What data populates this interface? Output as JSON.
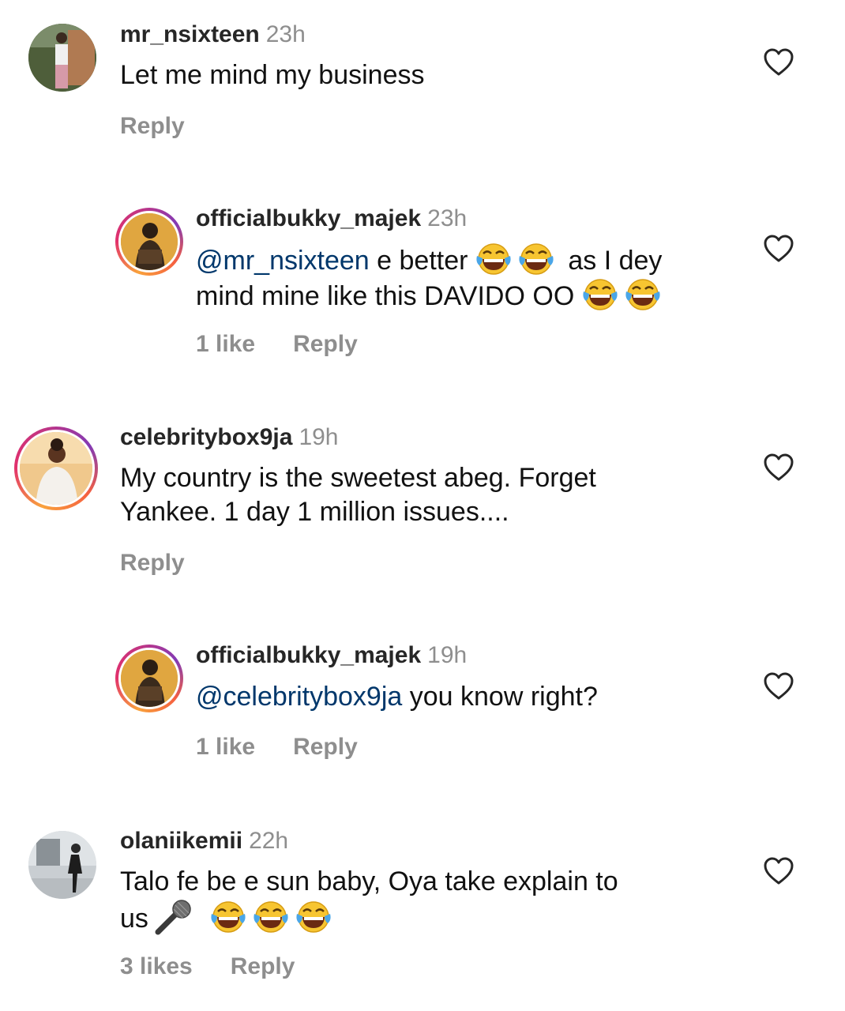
{
  "comments": [
    {
      "username": "mr_nsixteen",
      "time": "23h",
      "text": "Let me mind my business",
      "reply_label": "Reply"
    },
    {
      "username": "officialbukky_majek",
      "time": "23h",
      "mention": "@mr_nsixteen",
      "text_part1": " e better ",
      "text_part2": " as I dey",
      "text_line2": "mind mine like this DAVIDO OO ",
      "likes_label": "1 like",
      "reply_label": "Reply"
    },
    {
      "username": "celebritybox9ja",
      "time": "19h",
      "text_line1": "My country is the sweetest abeg. Forget",
      "text_line2": "Yankee. 1 day 1 million issues....",
      "reply_label": "Reply"
    },
    {
      "username": "officialbukky_majek",
      "time": "19h",
      "mention": "@celebritybox9ja",
      "text": " you know right?",
      "likes_label": "1 like",
      "reply_label": "Reply"
    },
    {
      "username": "olaniikemii",
      "time": "22h",
      "text_line1": "Talo fe be e sun baby, Oya take explain to",
      "text_line2": "us",
      "likes_label": "3 likes",
      "reply_label": "Reply"
    }
  ],
  "icons": {
    "heart": "heart-outline-icon",
    "laugh": "face-with-tears-of-joy-icon",
    "mic": "microphone-icon"
  },
  "colors": {
    "username": "#262626",
    "meta": "#8e8e8e",
    "mention": "#00376b",
    "story_ring": "#e1306c"
  }
}
